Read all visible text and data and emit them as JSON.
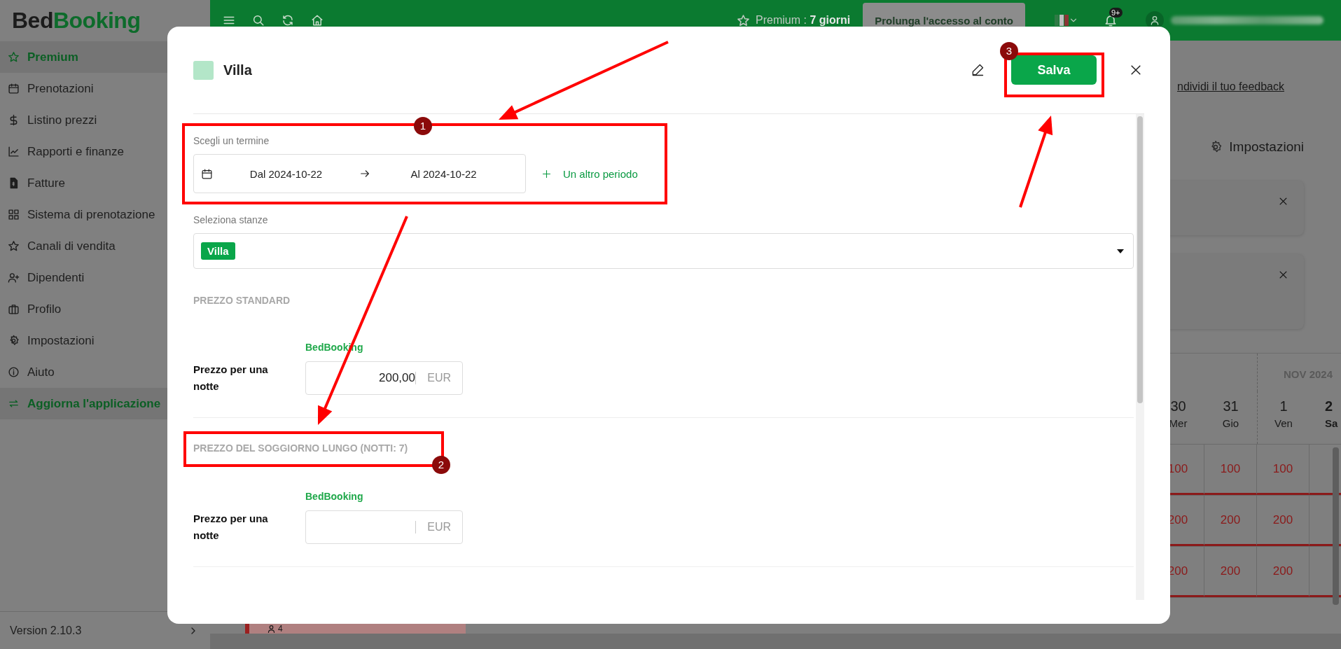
{
  "sidebar": {
    "logo": {
      "dark_part": "Bed",
      "brand_part": "Booking"
    },
    "items": [
      {
        "label": "Premium",
        "kind": "accent"
      },
      {
        "label": "Prenotazioni",
        "kind": "normal"
      },
      {
        "label": "Listino prezzi",
        "kind": "normal"
      },
      {
        "label": "Rapporti e finanze",
        "kind": "normal"
      },
      {
        "label": "Fatture",
        "kind": "normal"
      },
      {
        "label": "Sistema di prenotazione",
        "kind": "normal"
      },
      {
        "label": "Canali di vendita",
        "kind": "normal"
      },
      {
        "label": "Dipendenti",
        "kind": "normal"
      },
      {
        "label": "Profilo",
        "kind": "normal"
      },
      {
        "label": "Impostazioni",
        "kind": "normal"
      },
      {
        "label": "Aiuto",
        "kind": "normal"
      },
      {
        "label": "Aggiorna l'applicazione",
        "kind": "accent"
      }
    ],
    "version": "Version 2.10.3"
  },
  "top_bar": {
    "premium_status": "Premium : **7 giorni**",
    "extend_button": "Prolunga l'accesso al conto",
    "notification_badge": "9+"
  },
  "background": {
    "feedback_link": "ndividi il tuo feedback",
    "settings_button": "Impostazioni",
    "calendar": {
      "month": "NOV 2024",
      "days": [
        {
          "date": "30",
          "weekday": "Mer",
          "today": false,
          "prices": [
            "100",
            "200",
            "200"
          ]
        },
        {
          "date": "31",
          "weekday": "Gio",
          "today": false,
          "prices": [
            "100",
            "200",
            "200"
          ]
        },
        {
          "date": "1",
          "weekday": "Ven",
          "today": false,
          "prices": [
            "100",
            "200",
            "200"
          ]
        },
        {
          "date": "2",
          "weekday": "Sa",
          "today": true
        }
      ]
    },
    "booking_guests": "4"
  },
  "modal": {
    "title": "Villa",
    "color": "#b3e6c8",
    "save_button": "Salva",
    "period_label": "Scegli un termine",
    "date_from": "Dal 2024-10-22",
    "date_to": "Al 2024-10-22",
    "add_period_button": "Un altro periodo",
    "rooms_label": "Seleziona stanze",
    "selected_rooms": [
      "Villa"
    ],
    "sections": [
      {
        "heading": "PREZZO STANDARD",
        "channel": "BedBooking",
        "label": "Prezzo per una notte",
        "value": "200,00",
        "currency": "EUR"
      },
      {
        "heading": "PREZZO DEL SOGGIORNO LUNGO (NOTTI: 7)",
        "channel": "BedBooking",
        "label": "Prezzo per una notte",
        "currency": "EUR"
      }
    ]
  },
  "annotations": [
    {
      "number": "1"
    },
    {
      "number": "2"
    },
    {
      "number": "3"
    }
  ]
}
